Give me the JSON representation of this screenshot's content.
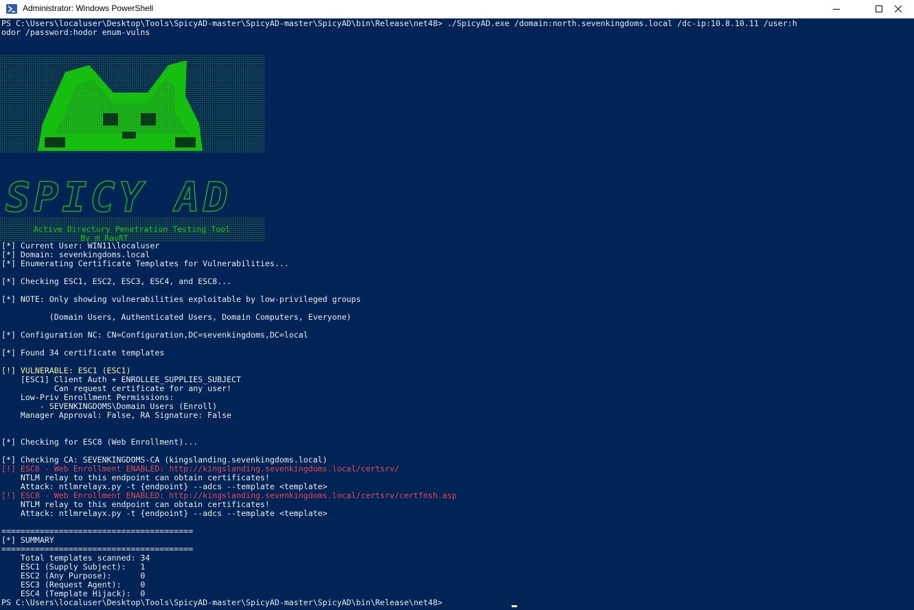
{
  "window": {
    "title": "Administrator: Windows PowerShell",
    "icon": "powershell-icon",
    "controls": [
      "minimize-icon",
      "maximize-icon",
      "close-icon"
    ]
  },
  "colors": {
    "background": "#012456",
    "text": "#eeedf0",
    "warning": "#f9f1a5",
    "error": "#e74856",
    "banner_green": "#16c60c"
  },
  "banner": {
    "logo_text": "SPICY AD",
    "subtitle": "Active Directory Penetration Testing Tool",
    "author": "By @_RayRT"
  },
  "terminal": {
    "command_line_1": "PS C:\\Users\\localuser\\Desktop\\Tools\\SpicyAD-master\\SpicyAD-master\\SpicyAD\\bin\\Release\\net48> ./SpicyAD.exe /domain:north.sevenkingdoms.local /dc-ip:10.8.10.11 /user:h",
    "command_line_2": "odor /password:hodor enum-vulns",
    "lines": [
      "[*] Current User: WIN11\\localuser",
      "[*] Domain: sevenkingdoms.local",
      "[*] Enumerating Certificate Templates for Vulnerabilities...",
      "[*] Checking ESC1, ESC2, ESC3, ESC4, and ESC8...",
      "[*] NOTE: Only showing vulnerabilities exploitable by low-privileged groups",
      "          (Domain Users, Authenticated Users, Domain Computers, Everyone)",
      "[*] Configuration NC: CN=Configuration,DC=sevenkingdoms,DC=local",
      "[*] Found 34 certificate templates",
      "[!] VULNERABLE: ESC1 (ESC1)",
      "    [ESC1] Client Auth + ENROLLEE_SUPPLIES_SUBJECT",
      "           Can request certificate for any user!",
      "    Low-Priv Enrollment Permissions:",
      "        - SEVENKINGDOMS\\Domain Users (Enroll)",
      "    Manager Approval: False, RA Signature: False",
      "[*] Checking for ESC8 (Web Enrollment)...",
      "[*] Checking CA: SEVENKINGDOMS-CA (kingslanding.sevenkingdoms.local)",
      "[!] ESC8 - Web Enrollment ENABLED: http://kingslanding.sevenkingdoms.local/certsrv/",
      "    NTLM relay to this endpoint can obtain certificates!",
      "    Attack: ntlmrelayx.py -t {endpoint} --adcs --template <template>",
      "[!] ESC8 - Web Enrollment ENABLED: http://kingslanding.sevenkingdoms.local/certsrv/certfnsh.asp",
      "    NTLM relay to this endpoint can obtain certificates!",
      "    Attack: ntlmrelayx.py -t {endpoint} --adcs --template <template>",
      "========================================",
      "[*] SUMMARY",
      "========================================",
      "    Total templates scanned: 34",
      "    ESC1 (Supply Subject):   1",
      "    ESC2 (Any Purpose):      0",
      "    ESC3 (Request Agent):    0",
      "    ESC4 (Template Hijack):  0"
    ],
    "prompt": "PS C:\\Users\\localuser\\Desktop\\Tools\\SpicyAD-master\\SpicyAD-master\\SpicyAD\\bin\\Release\\net48> "
  }
}
